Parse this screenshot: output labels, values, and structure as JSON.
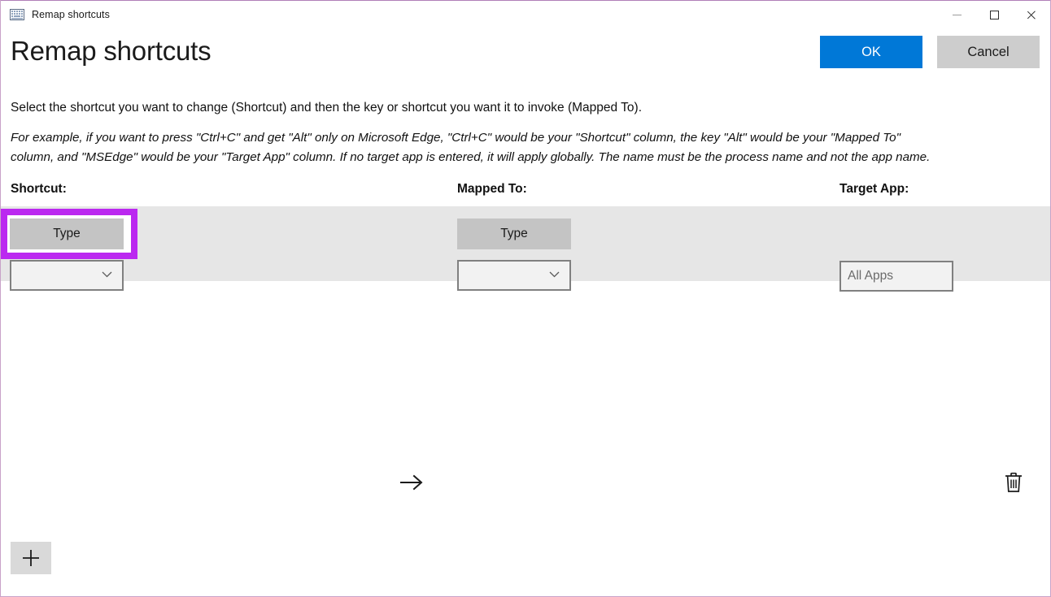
{
  "window": {
    "title": "Remap shortcuts",
    "icon": "keyboard-icon",
    "controls": {
      "minimize": "minimize-icon",
      "maximize": "maximize-icon",
      "close": "close-icon"
    }
  },
  "header": {
    "title": "Remap shortcuts",
    "ok_label": "OK",
    "cancel_label": "Cancel",
    "accent_color": "#0078d7",
    "cancel_color": "#cdcdcd"
  },
  "description": {
    "main": "Select the shortcut you want to change (Shortcut) and then the key or shortcut you want it to invoke (Mapped To).",
    "example_line1": "For example, if you want to press \"Ctrl+C\" and get \"Alt\" only on Microsoft Edge, \"Ctrl+C\" would be your \"Shortcut\" column, the key \"Alt\" would be your \"Mapped To\"",
    "example_line2": "column, and \"MSEdge\" would be your \"Target App\" column. If no target app is entered, it will apply globally. The name must be the process name and not the app name."
  },
  "columns": {
    "shortcut": "Shortcut:",
    "mapped_to": "Mapped To:",
    "target_app": "Target App:"
  },
  "row": {
    "shortcut_type_label": "Type",
    "shortcut_combo_value": "",
    "arrow": "arrow-right-icon",
    "mapped_type_label": "Type",
    "mapped_combo_value": "",
    "target_app_value": "",
    "target_app_placeholder": "All Apps",
    "delete_icon": "trash-icon",
    "highlight_color": "#bb28f0",
    "row_background": "#e6e6e6"
  },
  "add_row": {
    "icon": "plus-icon"
  }
}
